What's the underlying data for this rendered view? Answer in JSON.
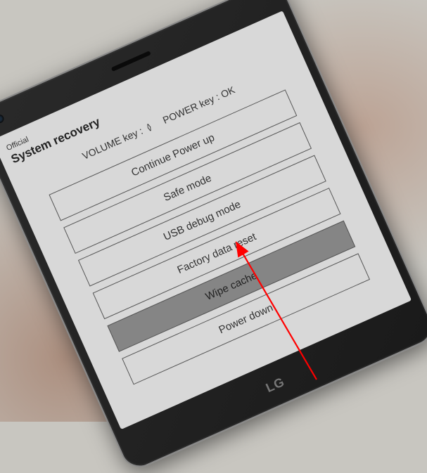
{
  "status": "Official",
  "title": "System recovery",
  "instructions": {
    "volume_label": "VOLUME key :",
    "power_label": "POWER key : OK"
  },
  "menu": {
    "items": [
      {
        "label": "Continue Power up",
        "selected": false
      },
      {
        "label": "Safe mode",
        "selected": false
      },
      {
        "label": "USB debug mode",
        "selected": false
      },
      {
        "label": "Factory data reset",
        "selected": false
      },
      {
        "label": "Wipe cache",
        "selected": true
      },
      {
        "label": "Power down",
        "selected": false
      }
    ]
  },
  "brand": "LG"
}
